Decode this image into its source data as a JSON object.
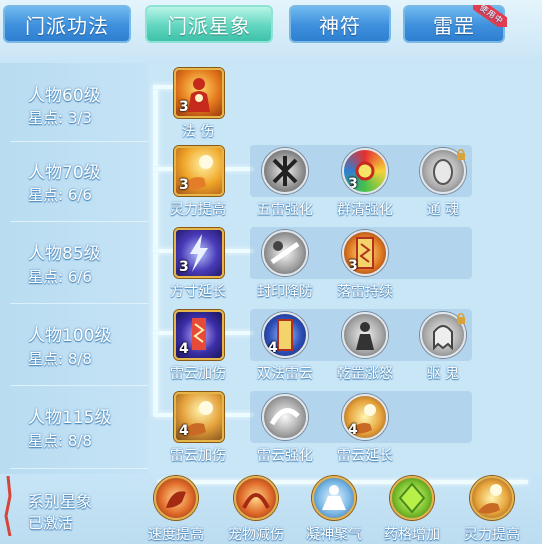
{
  "tabs": [
    {
      "label": "门派功法"
    },
    {
      "label": "门派星象"
    },
    {
      "label": "神符"
    },
    {
      "label": "雷罡",
      "badge": "使用中"
    }
  ],
  "levels": [
    {
      "level": "人物60级",
      "points": "星点: 3/3"
    },
    {
      "level": "人物70级",
      "points": "星点: 6/6"
    },
    {
      "level": "人物85级",
      "points": "星点: 6/6"
    },
    {
      "level": "人物100级",
      "points": "星点: 8/8"
    },
    {
      "level": "人物115级",
      "points": "星点: 8/8"
    }
  ],
  "rows": [
    {
      "main": {
        "name": "法 伤",
        "count": "3"
      },
      "subs": []
    },
    {
      "main": {
        "name": "灵力提高",
        "count": "3"
      },
      "subs": [
        {
          "name": "五雷强化",
          "count": ""
        },
        {
          "name": "群清强化",
          "count": "3"
        },
        {
          "name": "通 魂",
          "count": "",
          "locked": true
        }
      ]
    },
    {
      "main": {
        "name": "方寸延长",
        "count": "3"
      },
      "subs": [
        {
          "name": "封印降防",
          "count": ""
        },
        {
          "name": "落雷持续",
          "count": "3"
        }
      ]
    },
    {
      "main": {
        "name": "雷云加伤",
        "count": "4"
      },
      "subs": [
        {
          "name": "双法雷云",
          "count": "4"
        },
        {
          "name": "乾罡涨怒",
          "count": ""
        },
        {
          "name": "驱 鬼",
          "count": "",
          "locked": true
        }
      ]
    },
    {
      "main": {
        "name": "雷云加伤",
        "count": "4"
      },
      "subs": [
        {
          "name": "雷云强化",
          "count": ""
        },
        {
          "name": "雷云延长",
          "count": "4"
        }
      ]
    }
  ],
  "series": {
    "title": "系别星象",
    "status": "已激活",
    "items": [
      "速度提高",
      "宠物减伤",
      "凝神聚气",
      "药格增加",
      "灵力提高"
    ]
  },
  "colors": {
    "tab_blue": "#3e8fdc",
    "tab_active": "#3fc1aa",
    "badge": "#e23c4e",
    "skill_border": "#e7b64a"
  }
}
